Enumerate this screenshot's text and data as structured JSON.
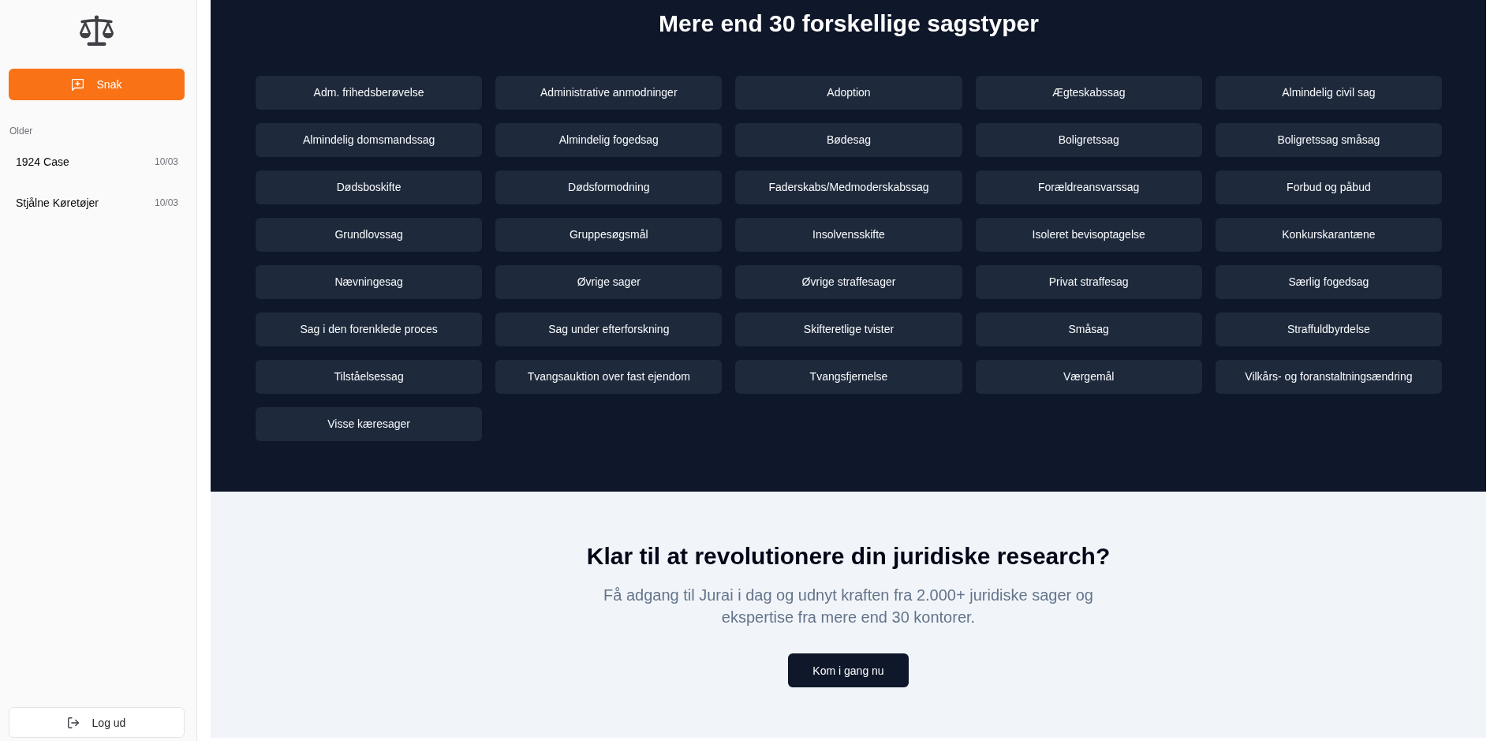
{
  "sidebar": {
    "new_chat_button": "Snak",
    "section_label": "Older",
    "chats": [
      {
        "title": "1924 Case",
        "date": "10/03"
      },
      {
        "title": "Stjålne Køretøjer",
        "date": "10/03"
      }
    ],
    "logout_button": "Log ud"
  },
  "case_types": {
    "title": "Mere end 30 forskellige sagstyper",
    "items": [
      "Adm. frihedsberøvelse",
      "Administrative anmodninger",
      "Adoption",
      "Ægteskabssag",
      "Almindelig civil sag",
      "Almindelig domsmandssag",
      "Almindelig fogedsag",
      "Bødesag",
      "Boligretssag",
      "Boligretssag småsag",
      "Dødsboskifte",
      "Dødsformodning",
      "Faderskabs/Medmoderskabssag",
      "Forældreansvarssag",
      "Forbud og påbud",
      "Grundlovssag",
      "Gruppesøgsmål",
      "Insolvensskifte",
      "Isoleret bevisoptagelse",
      "Konkurskarantæne",
      "Nævningesag",
      "Øvrige sager",
      "Øvrige straffesager",
      "Privat straffesag",
      "Særlig fogedsag",
      "Sag i den forenklede proces",
      "Sag under efterforskning",
      "Skifteretlige tvister",
      "Småsag",
      "Straffuldbyrdelse",
      "Tilståelsessag",
      "Tvangsauktion over fast ejendom",
      "Tvangsfjernelse",
      "Værgemål",
      "Vilkårs- og foranstaltningsændring",
      "Visse kæresager"
    ]
  },
  "cta": {
    "title": "Klar til at revolutionere din juridiske research?",
    "text": "Få adgang til Jurai i dag og udnyt kraften fra 2.000+ juridiske sager og ekspertise fra mere end 30 kontorer.",
    "button": "Kom i gang nu"
  }
}
